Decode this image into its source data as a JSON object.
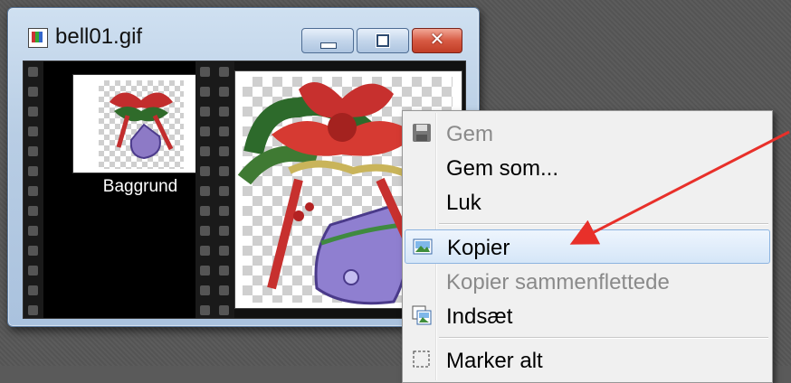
{
  "window": {
    "title": "bell01.gif",
    "icon": "image-file-icon",
    "controls": {
      "minimize": "minimize-icon",
      "maximize": "maximize-icon",
      "close": "✕"
    }
  },
  "layers": {
    "items": [
      {
        "label": "Baggrund"
      }
    ]
  },
  "context_menu": {
    "items": [
      {
        "label": "Gem",
        "icon": "floppy-disk-icon",
        "disabled": true
      },
      {
        "label": "Gem som...",
        "icon": "",
        "disabled": false
      },
      {
        "label": "Luk",
        "icon": "",
        "disabled": false
      },
      {
        "label": "Kopier",
        "icon": "copy-image-icon",
        "disabled": false,
        "highlighted": true
      },
      {
        "label": "Kopier sammenflettede",
        "icon": "",
        "disabled": true
      },
      {
        "label": "Indsæt",
        "icon": "paste-image-icon",
        "disabled": false
      },
      {
        "label": "Marker alt",
        "icon": "select-all-icon",
        "disabled": false
      }
    ]
  },
  "annotation": {
    "arrow_color": "#e8302a"
  }
}
